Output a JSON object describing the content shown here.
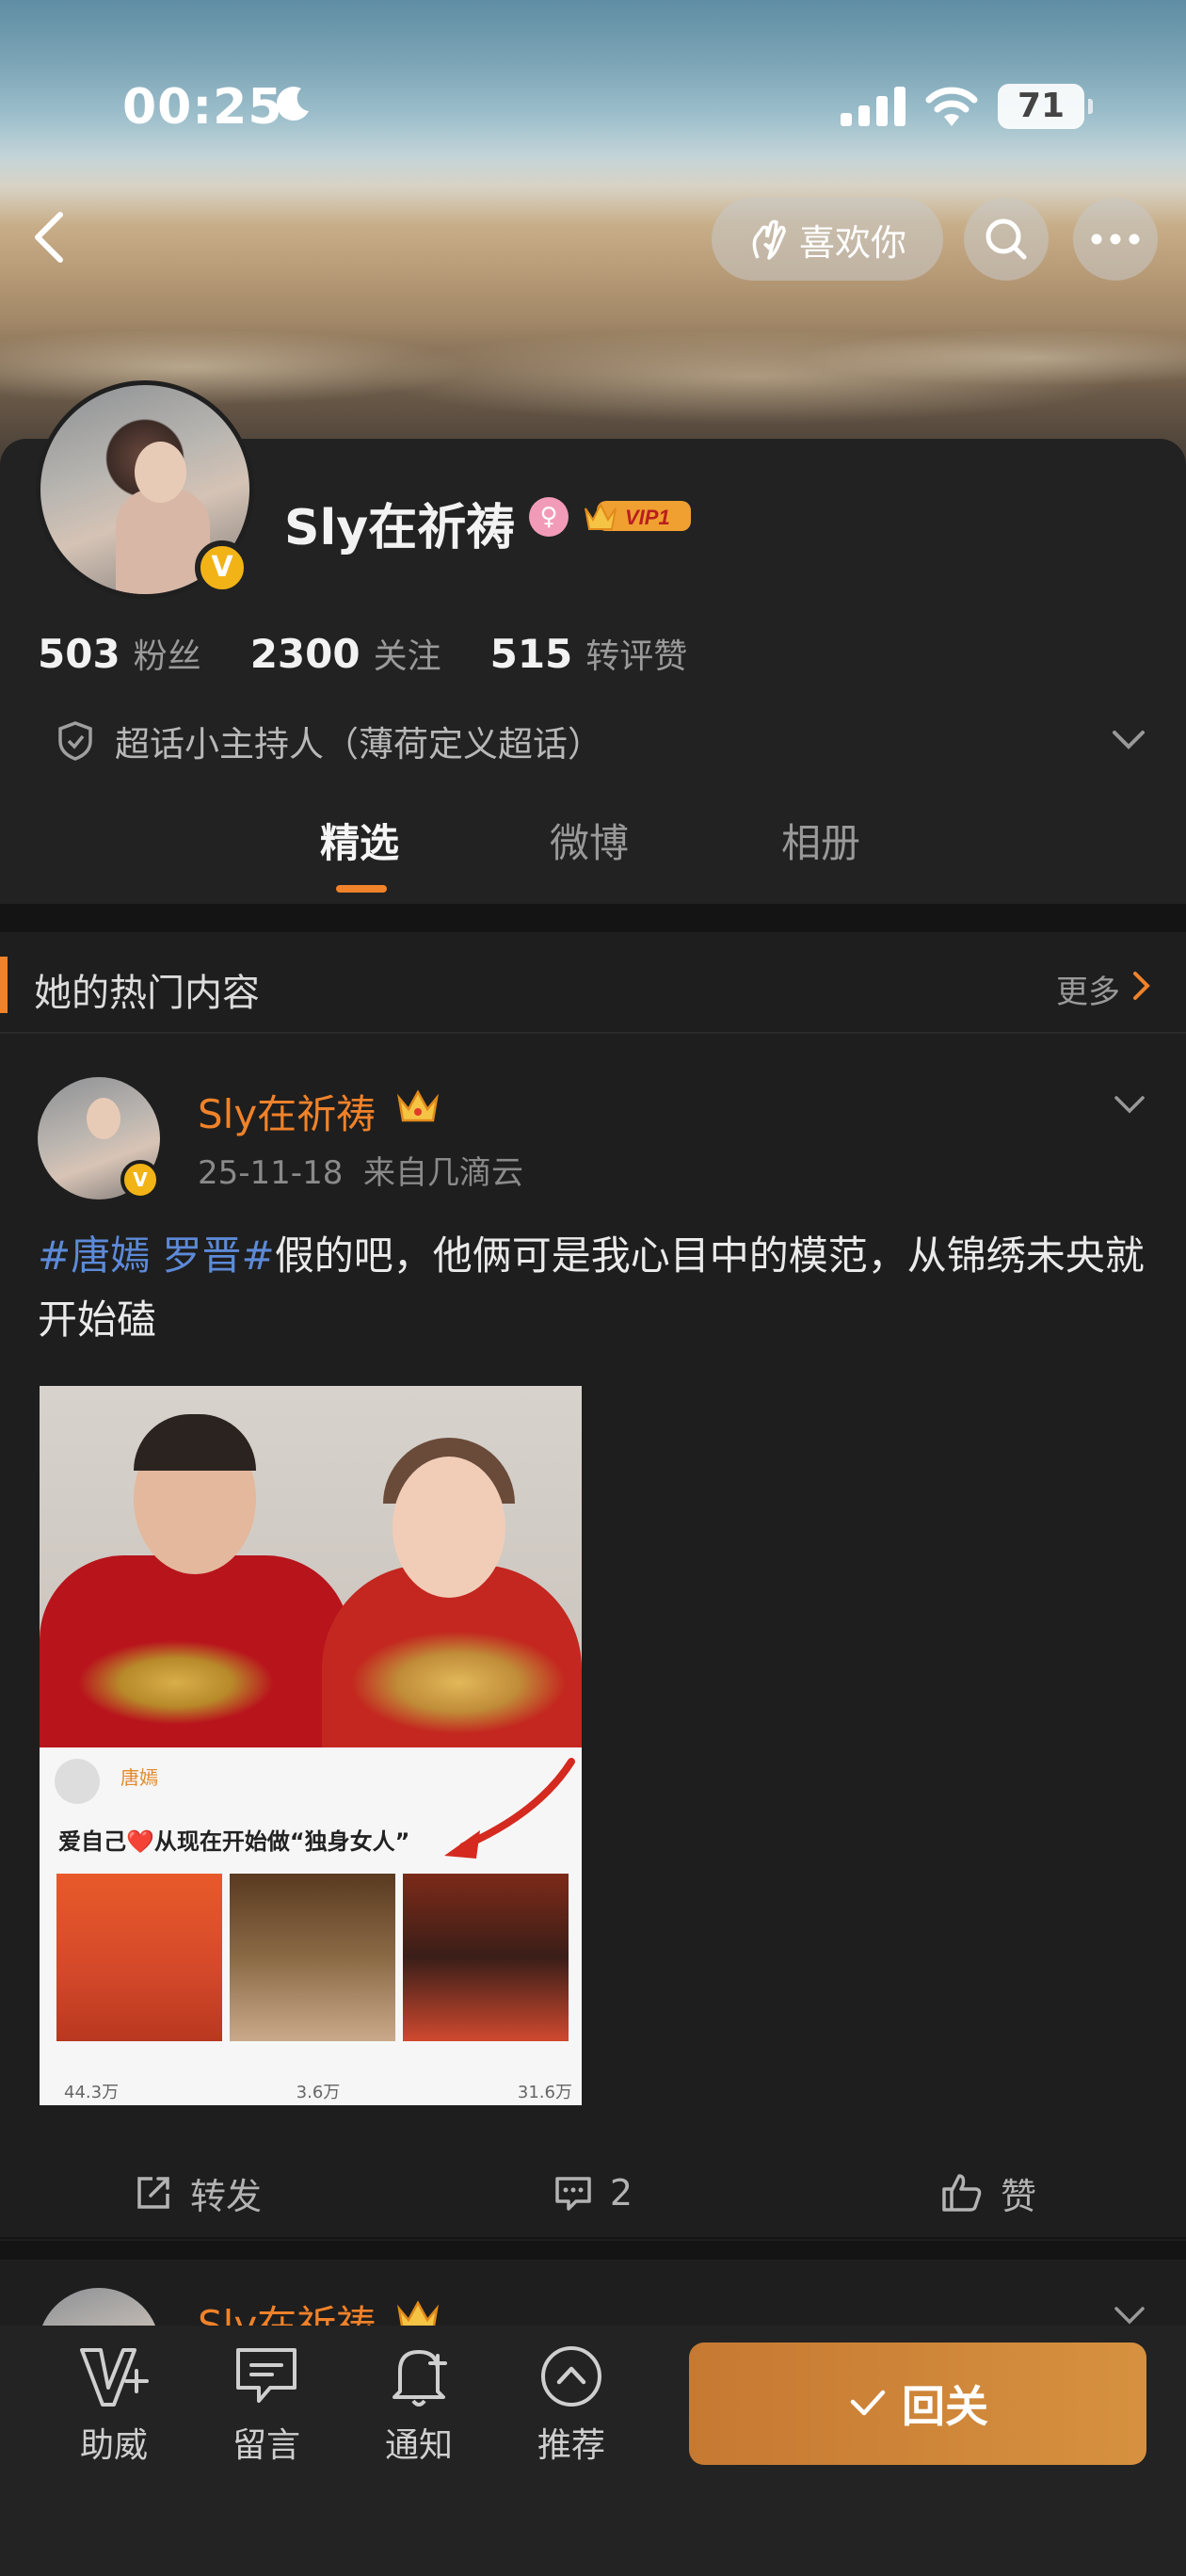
{
  "status_bar": {
    "time": "00:25",
    "battery": "71"
  },
  "header": {
    "like_label": "喜欢你"
  },
  "profile": {
    "name": "Sly在祈祷",
    "vip_label": "VIP1",
    "followers_count": "503",
    "followers_label": "粉丝",
    "following_count": "2300",
    "following_label": "关注",
    "interactions_count": "515",
    "interactions_label": "转评赞",
    "host_role": "超话小主持人（薄荷定义超话）"
  },
  "tabs": [
    "精选",
    "微博",
    "相册"
  ],
  "active_tab": 0,
  "hot_section": {
    "title": "她的热门内容",
    "more_label": "更多"
  },
  "post": {
    "author": "Sly在祈祷",
    "date": "25-11-18",
    "source": "来自几滴云",
    "hashtag": "#唐嫣 罗晋#",
    "text": "假的吧，他俩可是我心目中的模范，从锦绣未央就开始磕",
    "image": {
      "inner_name": "唐嫣",
      "inner_text": "爱自己❤️从现在开始做“独身女人”",
      "inner_stats": [
        "44.3万",
        "3.6万",
        "31.6万"
      ]
    },
    "actions": {
      "repost": "转发",
      "comments": "2",
      "like": "赞"
    }
  },
  "next_post": {
    "author": "Sly在祈祷"
  },
  "bottom_bar": {
    "items": [
      "助威",
      "留言",
      "通知",
      "推荐"
    ],
    "follow_label": "回关"
  },
  "colors": {
    "accent": "#f0822a",
    "hashtag": "#5d8ad8",
    "background": "#1e1e1e",
    "gold": "#f2b316"
  }
}
